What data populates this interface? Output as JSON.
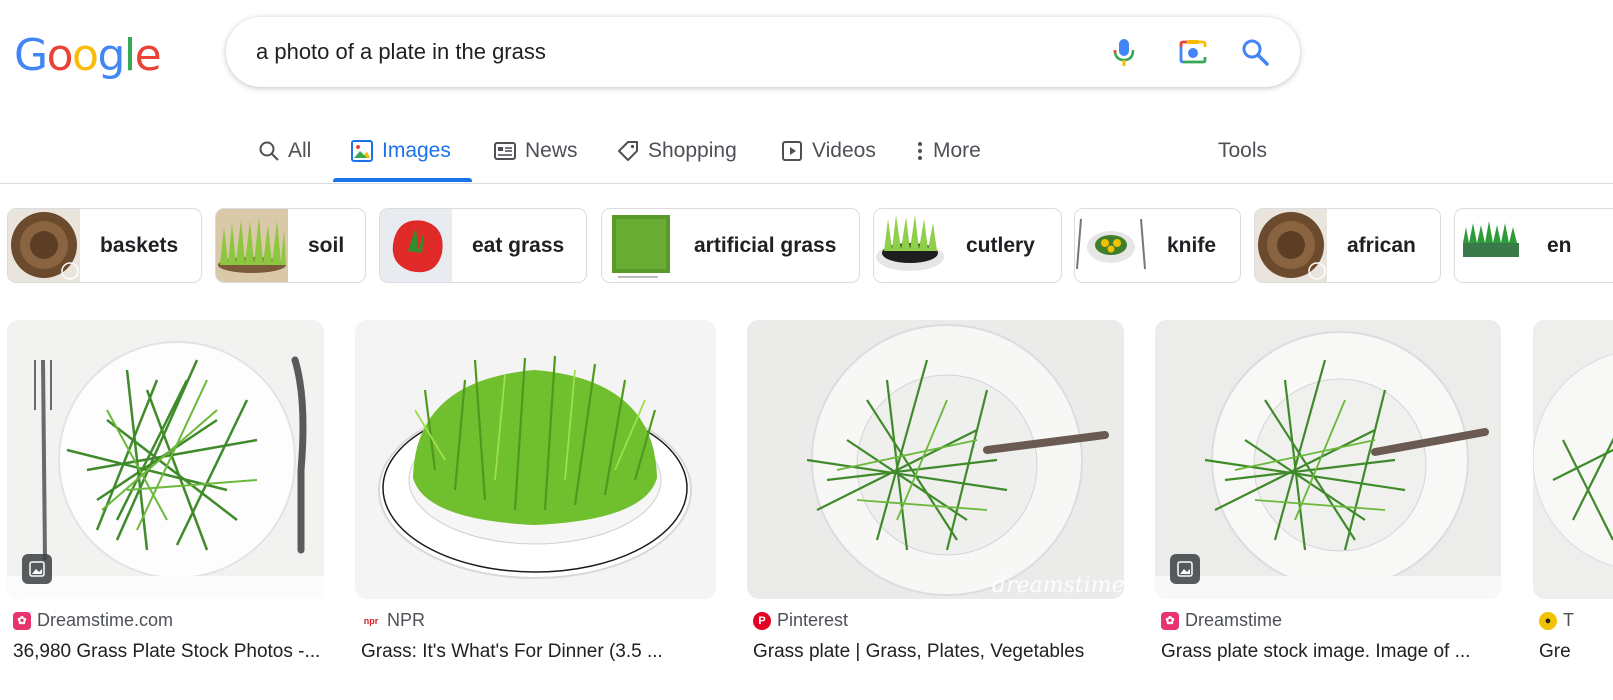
{
  "logo": {
    "letters": [
      "G",
      "o",
      "o",
      "g",
      "l",
      "e"
    ],
    "colors": [
      "#4285F4",
      "#EA4335",
      "#FBBC05",
      "#4285F4",
      "#34A853",
      "#EA4335"
    ]
  },
  "search": {
    "query": "a photo of a plate in the grass"
  },
  "tabs": [
    {
      "label": "All",
      "icon": "search-icon"
    },
    {
      "label": "Images",
      "icon": "image-icon",
      "active": true
    },
    {
      "label": "News",
      "icon": "news-icon"
    },
    {
      "label": "Shopping",
      "icon": "tag-icon"
    },
    {
      "label": "Videos",
      "icon": "play-icon"
    },
    {
      "label": "More",
      "icon": "more-vert-icon"
    }
  ],
  "tools_label": "Tools",
  "chips": [
    {
      "label": "baskets"
    },
    {
      "label": "soil"
    },
    {
      "label": "eat grass"
    },
    {
      "label": "artificial grass"
    },
    {
      "label": "cutlery"
    },
    {
      "label": "knife"
    },
    {
      "label": "african"
    },
    {
      "label": "en"
    }
  ],
  "results": [
    {
      "source": "Dreamstime.com",
      "title": "36,980 Grass Plate Stock Photos -...",
      "source_color": "#e8336d"
    },
    {
      "source": "NPR",
      "title": "Grass: It's What's For Dinner (3.5 ...",
      "source_color": "#d62021"
    },
    {
      "source": "Pinterest",
      "title": "Grass plate | Grass, Plates, Vegetables",
      "source_color": "#e60023"
    },
    {
      "source": "Dreamstime",
      "title": "Grass plate stock image. Image of ...",
      "source_color": "#e8336d"
    },
    {
      "source": "T",
      "title": "Gre",
      "source_color": "#202124"
    }
  ],
  "colors": {
    "accent": "#1a73e8",
    "text": "#202124",
    "muted": "#4d5156",
    "border": "#dadce0"
  }
}
